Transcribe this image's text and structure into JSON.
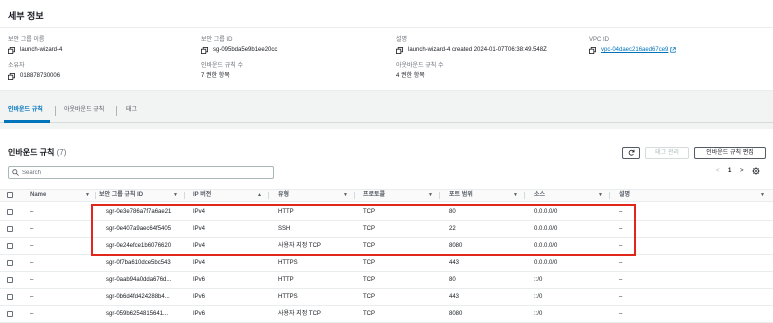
{
  "details": {
    "title": "세부 정보",
    "fields": {
      "sg_name": {
        "label": "보안 그룹 이름",
        "value": "launch-wizard-4"
      },
      "sg_id": {
        "label": "보안 그룹 ID",
        "value": "sg-095bda5e9b1ee20cc"
      },
      "description": {
        "label": "설명",
        "value": "launch-wizard-4 created 2024-01-07T06:38:49.548Z"
      },
      "vpc_id": {
        "label": "VPC ID",
        "value": "vpc-04daec216aed67ce9"
      },
      "owner": {
        "label": "소유자",
        "value": "018878730006"
      },
      "inbound_count": {
        "label": "인바운드 규칙 수",
        "value": "7 권한 항목"
      },
      "outbound_count": {
        "label": "아웃바운드 규칙 수",
        "value": "4 권한 항목"
      }
    }
  },
  "tabs": [
    "인바운드 규칙",
    "아웃바운드 규칙",
    "태그"
  ],
  "active_tab": "인바운드 규칙",
  "rules": {
    "title": "인바운드 규칙",
    "count": "(7)",
    "manage_tags_label": "태그 관리",
    "edit_label": "인바운드 규칙 편집",
    "search_placeholder": "Search",
    "pager": {
      "prev": "<",
      "page": "1",
      "next": ">"
    },
    "columns": [
      "Name",
      "보안 그룹 규칙 ID",
      "IP 버전",
      "유형",
      "프로토콜",
      "포트 범위",
      "소스",
      "설명"
    ],
    "rows": [
      {
        "name": "–",
        "id": "sgr-0e3e786a7f7a6ae21",
        "ip": "IPv4",
        "type": "HTTP",
        "protocol": "TCP",
        "port": "80",
        "source": "0.0.0.0/0",
        "desc": "–"
      },
      {
        "name": "–",
        "id": "sgr-0e407a9aec64f5405",
        "ip": "IPv4",
        "type": "SSH",
        "protocol": "TCP",
        "port": "22",
        "source": "0.0.0.0/0",
        "desc": "–"
      },
      {
        "name": "–",
        "id": "sgr-0e24efce1b6076620",
        "ip": "IPv4",
        "type": "사용자 지정 TCP",
        "protocol": "TCP",
        "port": "8080",
        "source": "0.0.0.0/0",
        "desc": "–"
      },
      {
        "name": "–",
        "id": "sgr-0f7ba610dce5bc543",
        "ip": "IPv4",
        "type": "HTTPS",
        "protocol": "TCP",
        "port": "443",
        "source": "0.0.0.0/0",
        "desc": "–"
      },
      {
        "name": "–",
        "id": "sgr-0aab94a0dda676d...",
        "ip": "IPv6",
        "type": "HTTP",
        "protocol": "TCP",
        "port": "80",
        "source": "::/0",
        "desc": "–"
      },
      {
        "name": "–",
        "id": "sgr-0b6d4fd424288b4...",
        "ip": "IPv6",
        "type": "HTTPS",
        "protocol": "TCP",
        "port": "443",
        "source": "::/0",
        "desc": "–"
      },
      {
        "name": "–",
        "id": "sgr-059b6254815641...",
        "ip": "IPv6",
        "type": "사용자 지정 TCP",
        "protocol": "TCP",
        "port": "8080",
        "source": "::/0",
        "desc": "–"
      }
    ]
  },
  "colors": {
    "link": "#0073bb",
    "highlight": "#e1261c"
  },
  "icons": [
    "copy-icon",
    "external-link-icon",
    "refresh-icon",
    "search-icon",
    "settings-gear-icon",
    "sort-caret-icon"
  ]
}
